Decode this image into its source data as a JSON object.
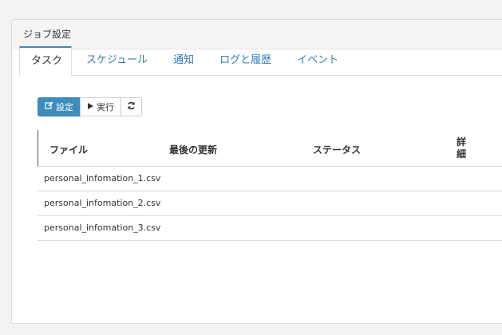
{
  "panel": {
    "title": "ジョブ設定"
  },
  "tabs": [
    {
      "label": "タスク"
    },
    {
      "label": "スケジュール"
    },
    {
      "label": "通知"
    },
    {
      "label": "ログと履歴"
    },
    {
      "label": "イベント"
    }
  ],
  "toolbar": {
    "settings_label": "設定",
    "run_label": "実行"
  },
  "table": {
    "headers": [
      "ファイル",
      "最後の更新",
      "ステータス",
      "詳細"
    ],
    "rows": [
      {
        "file": "personal_infomation_1.csv"
      },
      {
        "file": "personal_infomation_2.csv"
      },
      {
        "file": "personal_infomation_3.csv"
      }
    ]
  },
  "colors": {
    "accent": "#3c8dbc",
    "link": "#337ab7"
  },
  "icons": {
    "settings": "edit-icon",
    "run": "play-icon",
    "refresh": "refresh-icon"
  }
}
